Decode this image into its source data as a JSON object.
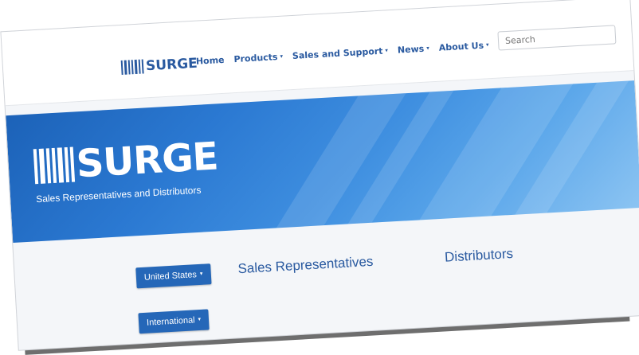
{
  "brand": {
    "logo_text": "SURGE"
  },
  "nav": {
    "items": [
      {
        "label": "Home",
        "dropdown": false
      },
      {
        "label": "Products",
        "dropdown": true
      },
      {
        "label": "Sales and Support",
        "dropdown": true
      },
      {
        "label": "News",
        "dropdown": true
      },
      {
        "label": "About Us",
        "dropdown": true
      }
    ],
    "caret": "▾"
  },
  "search": {
    "placeholder": "Search"
  },
  "hero": {
    "logo_text": "SURGE",
    "subtitle": "Sales Representatives and Distributors"
  },
  "content": {
    "country_button": "United States",
    "international_button": "International",
    "sales_reps_heading": "Sales Representatives",
    "distributors_heading": "Distributors"
  },
  "colors": {
    "accent": "#2a5aa0",
    "button": "#2567b8",
    "hero_blue": "#2b79d2"
  }
}
